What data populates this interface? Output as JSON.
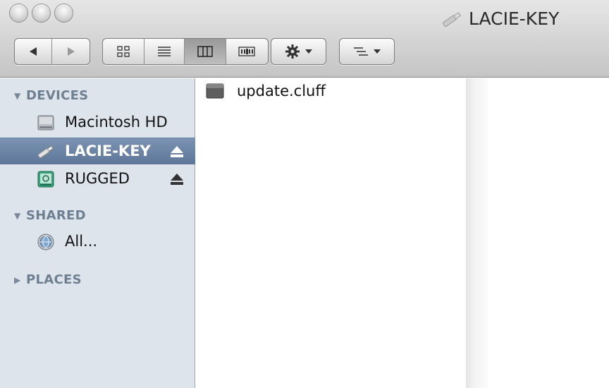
{
  "window": {
    "title": "LACIE-KEY"
  },
  "sidebar": {
    "sections": [
      {
        "label": "DEVICES",
        "expanded": true
      },
      {
        "label": "SHARED",
        "expanded": true
      },
      {
        "label": "PLACES",
        "expanded": false
      }
    ],
    "devices": [
      {
        "label": "Macintosh HD",
        "icon": "hard-drive-icon",
        "selected": false,
        "ejectable": false
      },
      {
        "label": "LACIE-KEY",
        "icon": "usb-key-icon",
        "selected": true,
        "ejectable": true
      },
      {
        "label": "RUGGED",
        "icon": "external-drive-icon",
        "selected": false,
        "ejectable": true
      }
    ],
    "shared": [
      {
        "label": "All...",
        "icon": "network-globe-icon"
      }
    ]
  },
  "files": [
    {
      "name": "update.cluff",
      "icon": "document-icon"
    }
  ],
  "colors": {
    "sidebar_bg": "#dde4ec",
    "selection": "#6a82a4",
    "section_header": "#6f7f92"
  }
}
